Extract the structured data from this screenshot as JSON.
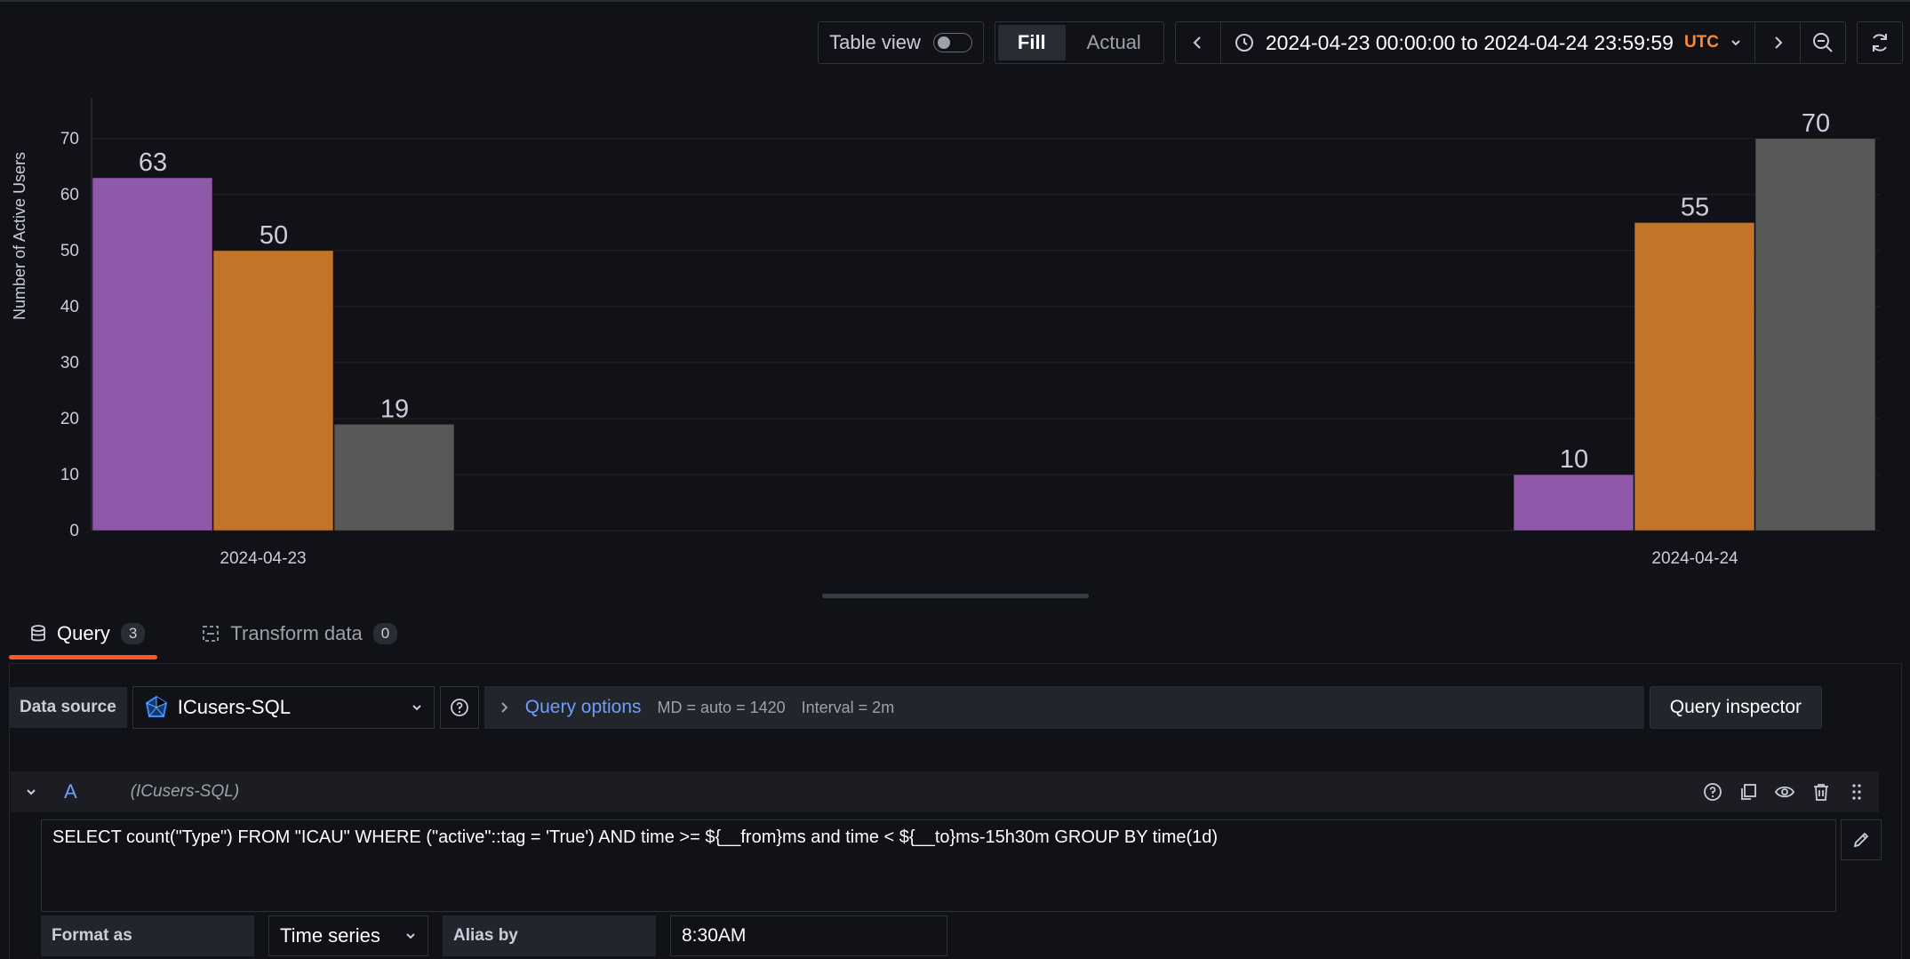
{
  "toolbar": {
    "table_view_label": "Table view",
    "fill_label": "Fill",
    "actual_label": "Actual",
    "time_range": "2024-04-23 00:00:00 to 2024-04-24 23:59:59",
    "timezone": "UTC"
  },
  "chart_data": {
    "type": "bar",
    "categories": [
      "2024-04-23",
      "2024-04-24"
    ],
    "series": [
      {
        "values": [
          63,
          10
        ],
        "color": "#9b5fb5"
      },
      {
        "values": [
          50,
          55
        ],
        "color": "#d17d2a"
      },
      {
        "values": [
          19,
          70
        ],
        "color": "#5e5e5e"
      }
    ],
    "ylabel": "Number of Active Users",
    "yticks": [
      0,
      10,
      20,
      30,
      40,
      50,
      60,
      70
    ],
    "ylim": [
      0,
      76
    ],
    "grid": true
  },
  "tabs": [
    {
      "label": "Query",
      "count": "3"
    },
    {
      "label": "Transform data",
      "count": "0"
    }
  ],
  "query_row": {
    "datasource_label": "Data source",
    "datasource_value": "ICusers-SQL",
    "options_title": "Query options",
    "md": "MD = auto = 1420",
    "interval": "Interval = 2m",
    "inspector_label": "Query inspector"
  },
  "query_a": {
    "letter": "A",
    "source": "(ICusers-SQL)",
    "sql": "SELECT count(\"Type\") FROM \"ICAU\" WHERE (\"active\"::tag = 'True') AND time >= ${__from}ms and time < ${__to}ms-15h30m GROUP BY time(1d)",
    "format_label": "Format as",
    "format_value": "Time series",
    "alias_label": "Alias by",
    "alias_value": "8:30AM"
  }
}
